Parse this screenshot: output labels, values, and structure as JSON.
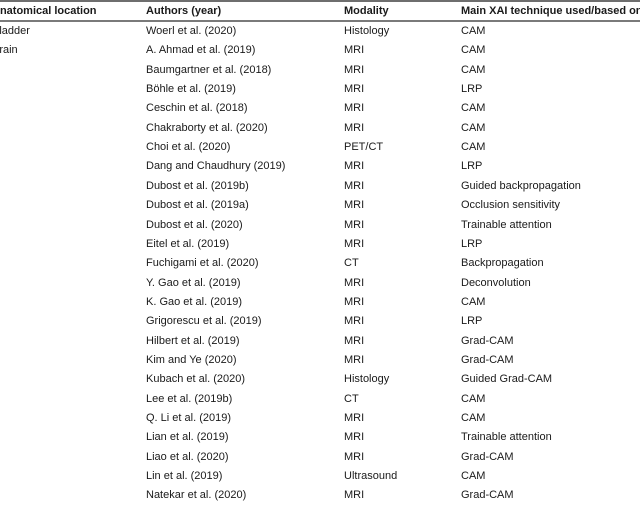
{
  "table": {
    "headers": {
      "location": "Anatomical location",
      "authors": "Authors (year)",
      "modality": "Modality",
      "technique": "Main XAI technique used/based on"
    },
    "rows": [
      {
        "location": "Bladder",
        "authors": "Woerl et al. (2020)",
        "modality": "Histology",
        "technique": "CAM"
      },
      {
        "location": "Brain",
        "authors": "A. Ahmad et al. (2019)",
        "modality": "MRI",
        "technique": "CAM"
      },
      {
        "location": "",
        "authors": "Baumgartner et al. (2018)",
        "modality": "MRI",
        "technique": "CAM"
      },
      {
        "location": "",
        "authors": "Böhle et al. (2019)",
        "modality": "MRI",
        "technique": "LRP"
      },
      {
        "location": "",
        "authors": "Ceschin et al. (2018)",
        "modality": "MRI",
        "technique": "CAM"
      },
      {
        "location": "",
        "authors": "Chakraborty et al. (2020)",
        "modality": "MRI",
        "technique": "CAM"
      },
      {
        "location": "",
        "authors": "Choi et al. (2020)",
        "modality": "PET/CT",
        "technique": "CAM"
      },
      {
        "location": "",
        "authors": "Dang and Chaudhury (2019)",
        "modality": "MRI",
        "technique": "LRP"
      },
      {
        "location": "",
        "authors": "Dubost et al. (2019b)",
        "modality": "MRI",
        "technique": "Guided backpropagation"
      },
      {
        "location": "",
        "authors": "Dubost et al. (2019a)",
        "modality": "MRI",
        "technique": "Occlusion sensitivity"
      },
      {
        "location": "",
        "authors": "Dubost et al. (2020)",
        "modality": "MRI",
        "technique": "Trainable attention"
      },
      {
        "location": "",
        "authors": "Eitel et al. (2019)",
        "modality": "MRI",
        "technique": "LRP"
      },
      {
        "location": "",
        "authors": "Fuchigami et al. (2020)",
        "modality": "CT",
        "technique": "Backpropagation"
      },
      {
        "location": "",
        "authors": "Y. Gao et al. (2019)",
        "modality": "MRI",
        "technique": "Deconvolution"
      },
      {
        "location": "",
        "authors": "K. Gao et al. (2019)",
        "modality": "MRI",
        "technique": "CAM"
      },
      {
        "location": "",
        "authors": "Grigorescu et al. (2019)",
        "modality": "MRI",
        "technique": "LRP"
      },
      {
        "location": "",
        "authors": "Hilbert et al. (2019)",
        "modality": "MRI",
        "technique": "Grad-CAM"
      },
      {
        "location": "",
        "authors": "Kim and Ye (2020)",
        "modality": "MRI",
        "technique": "Grad-CAM"
      },
      {
        "location": "",
        "authors": "Kubach et al. (2020)",
        "modality": "Histology",
        "technique": "Guided Grad-CAM"
      },
      {
        "location": "",
        "authors": "Lee et al. (2019b)",
        "modality": "CT",
        "technique": "CAM"
      },
      {
        "location": "",
        "authors": "Q. Li et al. (2019)",
        "modality": "MRI",
        "technique": "CAM"
      },
      {
        "location": "",
        "authors": "Lian et al. (2019)",
        "modality": "MRI",
        "technique": "Trainable attention"
      },
      {
        "location": "",
        "authors": "Liao et al. (2020)",
        "modality": "MRI",
        "technique": "Grad-CAM"
      },
      {
        "location": "",
        "authors": "Lin et al. (2019)",
        "modality": "Ultrasound",
        "technique": "CAM"
      },
      {
        "location": "",
        "authors": "Natekar et al. (2020)",
        "modality": "MRI",
        "technique": "Grad-CAM"
      }
    ]
  }
}
